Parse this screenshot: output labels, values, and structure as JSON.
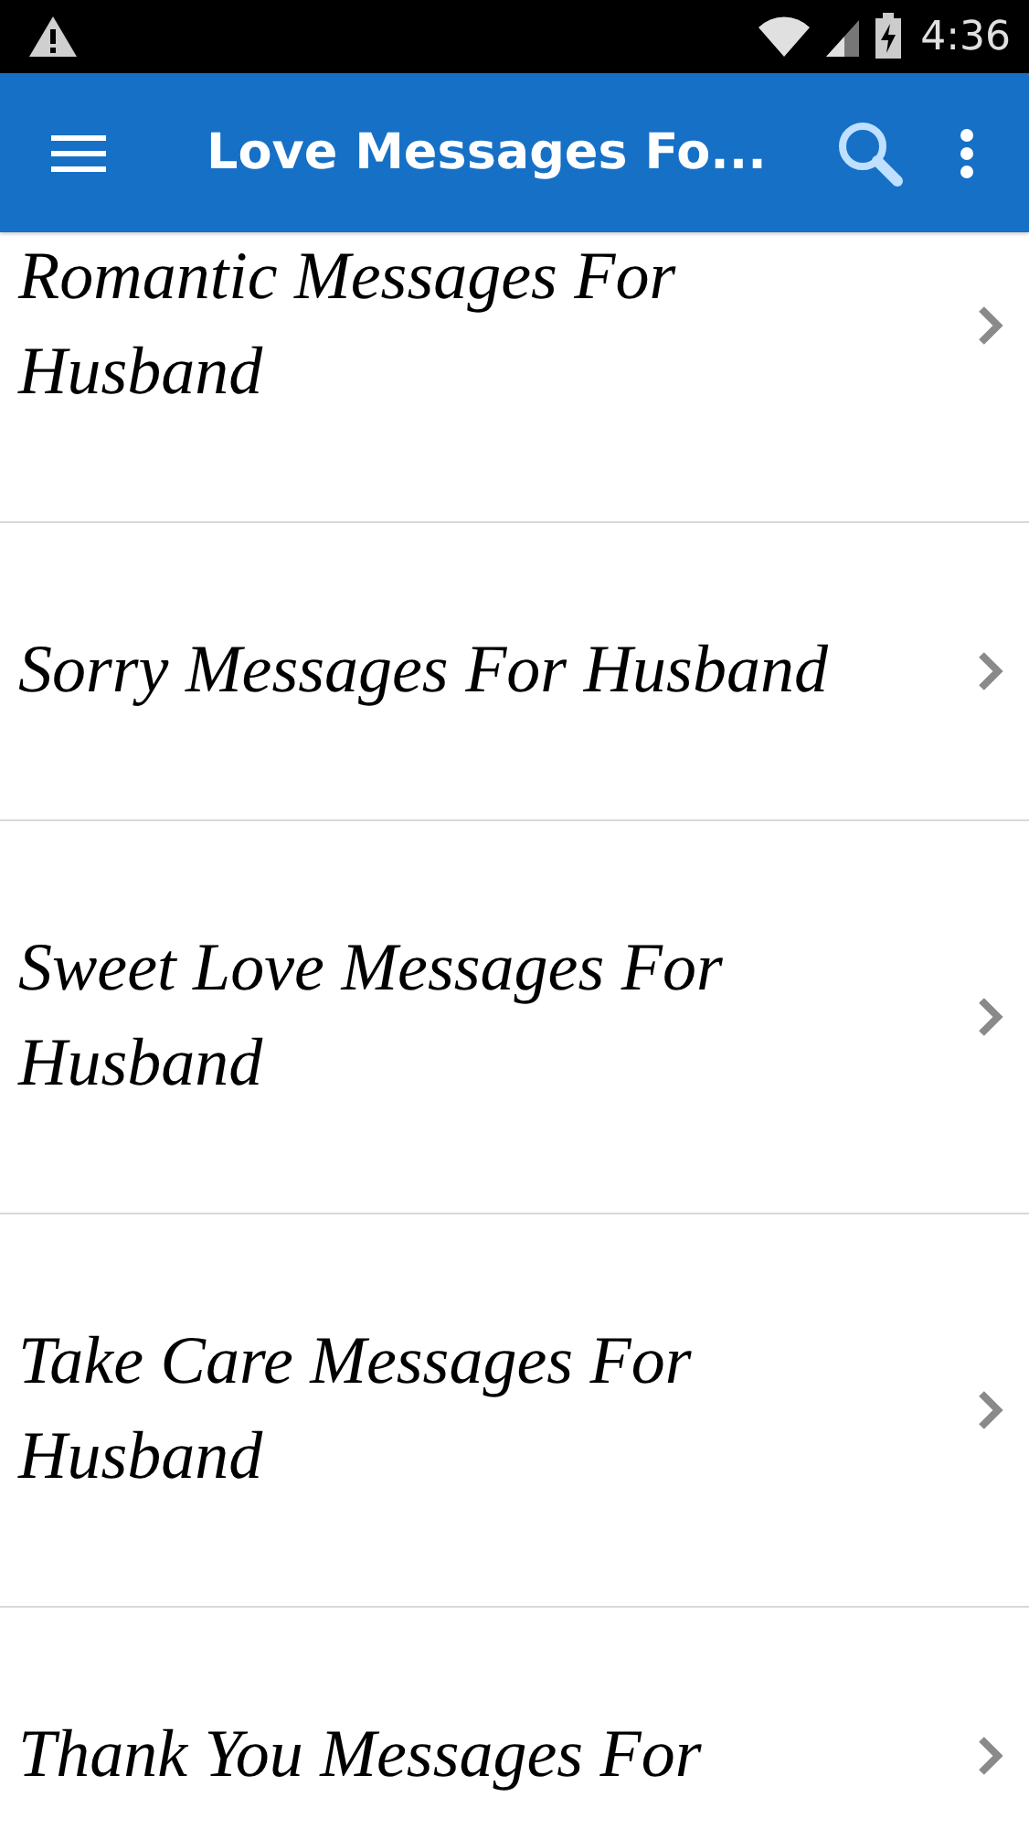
{
  "status_bar": {
    "time": "4:36"
  },
  "app_bar": {
    "title": "Love Messages Fo..."
  },
  "list": [
    {
      "label": "Romantic Messages For Husband"
    },
    {
      "label": "Sorry Messages For Husband"
    },
    {
      "label": "Sweet Love Messages For Husband"
    },
    {
      "label": "Take Care Messages For Husband"
    },
    {
      "label": "Thank You Messages For"
    }
  ]
}
